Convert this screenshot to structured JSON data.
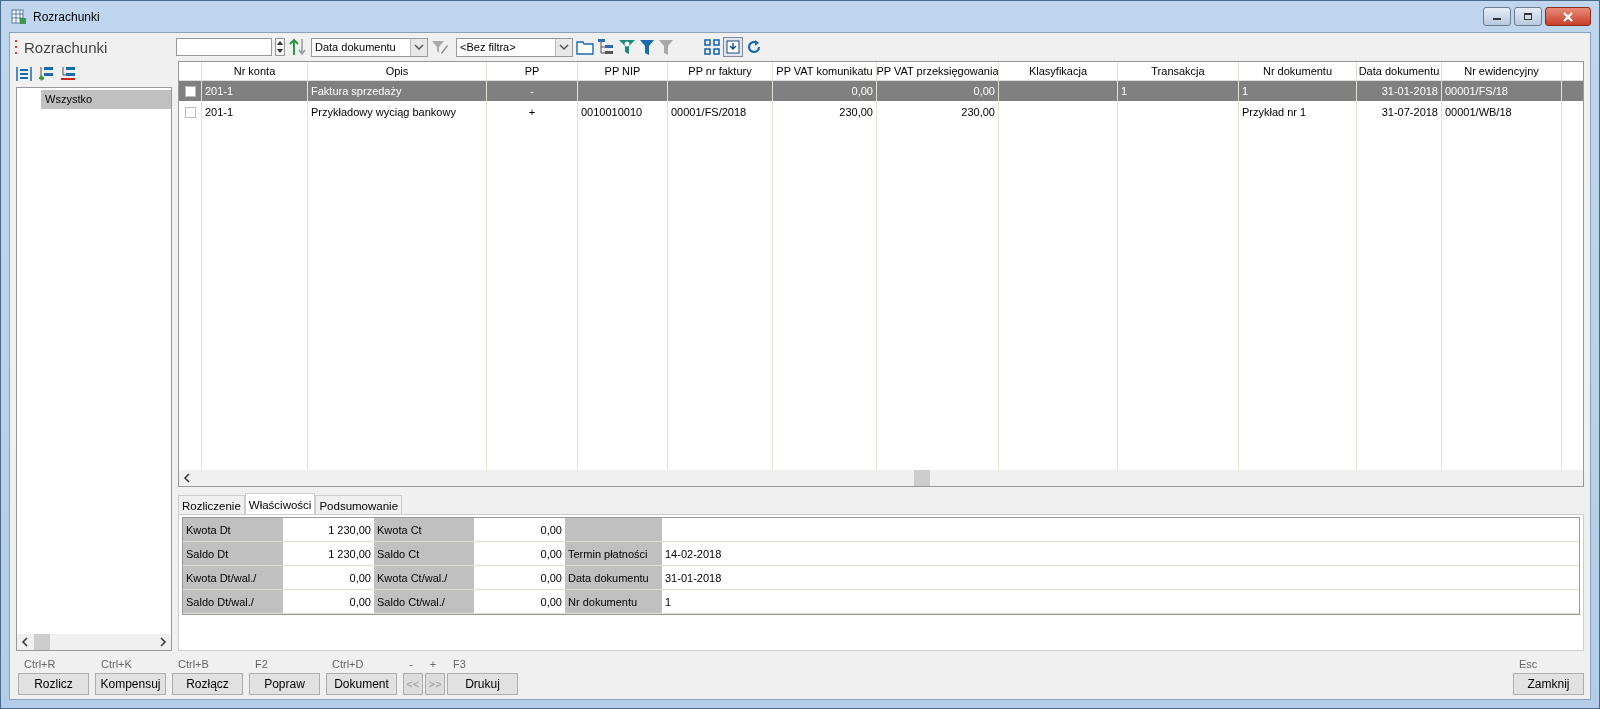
{
  "window": {
    "title": "Rozrachunki"
  },
  "panel_title": "Rozrachunki",
  "toolbar": {
    "sort_field": "Data dokumentu",
    "filter_field": "<Bez filtra>"
  },
  "tree": {
    "items": [
      {
        "label": "Wszystko",
        "selected": true
      }
    ]
  },
  "table": {
    "columns": [
      {
        "label": "Nr konta"
      },
      {
        "label": "Opis"
      },
      {
        "label": "PP"
      },
      {
        "label": "PP NIP"
      },
      {
        "label": "PP nr faktury"
      },
      {
        "label": "PP VAT komunikatu"
      },
      {
        "label": "PP VAT przeksięgowania"
      },
      {
        "label": "Klasyfikacja"
      },
      {
        "label": "Transakcja"
      },
      {
        "label": "Nr dokumentu"
      },
      {
        "label": "Data dokumentu"
      },
      {
        "label": "Nr ewidencyjny"
      }
    ],
    "rows": [
      {
        "selected": true,
        "checked": false,
        "cells": [
          "201-1",
          "Faktura sprzedaży",
          "-",
          "",
          "",
          "0,00",
          "0,00",
          "",
          "1",
          "1",
          "31-01-2018",
          "00001/FS/18"
        ]
      },
      {
        "selected": false,
        "checked": false,
        "cells": [
          "201-1",
          "Przykładowy wyciąg bankowy",
          "+",
          "0010010010",
          "00001/FS/2018",
          "230,00",
          "230,00",
          "",
          "",
          "Przykład nr 1",
          "31-07-2018",
          "00001/WB/18"
        ]
      }
    ]
  },
  "tabs": [
    {
      "label": "Rozliczenie",
      "selected": false
    },
    {
      "label": "Właściwości",
      "selected": true
    },
    {
      "label": "Podsumowanie",
      "selected": false
    }
  ],
  "properties": [
    {
      "cells": [
        {
          "label": "Kwota Dt",
          "value": "1 230,00"
        },
        {
          "label": "Kwota Ct",
          "value": "0,00"
        }
      ]
    },
    {
      "cells": [
        {
          "label": "Saldo Dt",
          "value": "1 230,00"
        },
        {
          "label": "Saldo Ct",
          "value": "0,00"
        },
        {
          "label": "Termin płatności",
          "value": "14-02-2018"
        }
      ]
    },
    {
      "cells": [
        {
          "label": "Kwota Dt/wal./",
          "value": "0,00"
        },
        {
          "label": "Kwota Ct/wal./",
          "value": "0,00"
        },
        {
          "label": "Data dokumentu",
          "value": "31-01-2018"
        }
      ]
    },
    {
      "cells": [
        {
          "label": "Saldo Dt/wal./",
          "value": "0,00"
        },
        {
          "label": "Saldo Ct/wal./",
          "value": "0,00"
        },
        {
          "label": "Nr dokumentu",
          "value": "1"
        }
      ]
    }
  ],
  "buttons": [
    {
      "shortcut": "Ctrl+R",
      "label": "Rozlicz",
      "kind": "wide",
      "disabled": false
    },
    {
      "shortcut": "Ctrl+K",
      "label": "Kompensuj",
      "kind": "wide",
      "disabled": false
    },
    {
      "shortcut": "Ctrl+B",
      "label": "Rozłącz",
      "kind": "wide",
      "disabled": false
    },
    {
      "shortcut": "F2",
      "label": "Popraw",
      "kind": "wide",
      "disabled": false
    },
    {
      "shortcut": "Ctrl+D",
      "label": "Dokument",
      "kind": "wide",
      "disabled": false
    },
    {
      "shortcut": "-",
      "label": "<<",
      "kind": "nav",
      "disabled": true
    },
    {
      "shortcut": "+",
      "label": ">>",
      "kind": "nav",
      "disabled": true
    },
    {
      "shortcut": "F3",
      "label": "Drukuj",
      "kind": "wide",
      "disabled": false
    }
  ],
  "close_button": {
    "shortcut": "Esc",
    "label": "Zamknij"
  }
}
